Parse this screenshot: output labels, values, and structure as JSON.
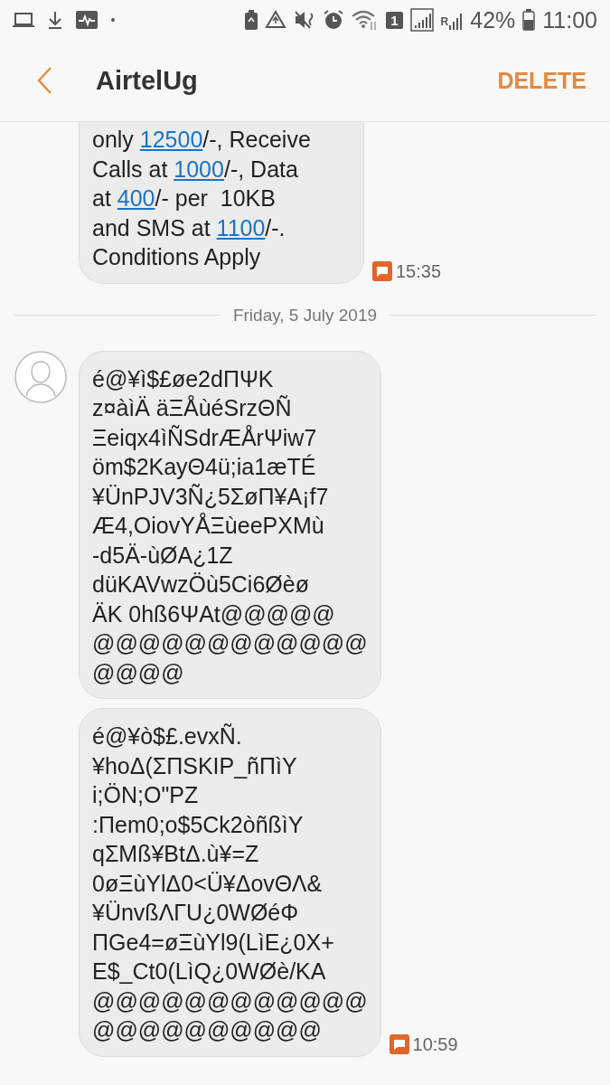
{
  "status_bar": {
    "sim_badge": "1",
    "roaming": "R",
    "battery": "42%",
    "time": "11:00"
  },
  "header": {
    "title": "AirtelUg",
    "action": "DELETE"
  },
  "messages": [
    {
      "kind": "incoming",
      "avatar": false,
      "time": "15:35",
      "lines": [
        [
          {
            "kind": "text",
            "text": "only "
          },
          {
            "kind": "link",
            "text": "12500"
          },
          {
            "kind": "text",
            "text": "/-, Receive"
          }
        ],
        [
          {
            "kind": "text",
            "text": "Calls at "
          },
          {
            "kind": "link",
            "text": "1000"
          },
          {
            "kind": "text",
            "text": "/-, Data"
          }
        ],
        [
          {
            "kind": "text",
            "text": "at "
          },
          {
            "kind": "link",
            "text": "400"
          },
          {
            "kind": "text",
            "text": "/- per  10KB"
          }
        ],
        [
          {
            "kind": "text",
            "text": "and SMS at "
          },
          {
            "kind": "link",
            "text": "1100"
          },
          {
            "kind": "text",
            "text": "/-."
          }
        ],
        [
          {
            "kind": "text",
            "text": "Conditions Apply"
          }
        ]
      ]
    },
    {
      "kind": "date",
      "text": "Friday, 5 July 2019"
    },
    {
      "kind": "incoming",
      "avatar": true,
      "lines": [
        [
          {
            "kind": "text",
            "text": "é@¥ì$£øe2dΠΨK"
          }
        ],
        [
          {
            "kind": "text",
            "text": "z¤àìÄ äΞÅùéSrzΘÑ"
          }
        ],
        [
          {
            "kind": "text",
            "text": "Ξeiqx4ìÑSdrÆÅrΨiw7"
          }
        ],
        [
          {
            "kind": "text",
            "text": "öm$2KayΘ4ü;ia1æTÉ"
          }
        ],
        [
          {
            "kind": "text",
            "text": "¥ÜnPJV3Ñ¿5ΣøΠ¥A¡f7"
          }
        ],
        [
          {
            "kind": "text",
            "text": "Æ4,OiovYÅΞùeePXMù"
          }
        ],
        [
          {
            "kind": "text",
            "text": "-d5Ä-ùØA¿1Z"
          }
        ],
        [
          {
            "kind": "text",
            "text": "düKAVwzÖù5Ci6Øèø"
          }
        ],
        [
          {
            "kind": "text",
            "text": "ÄK 0hß6ΨAt@@@@@"
          }
        ],
        [
          {
            "kind": "text",
            "text": "@@@@@@@@@@@@"
          }
        ],
        [
          {
            "kind": "text",
            "text": "@@@@"
          }
        ]
      ]
    },
    {
      "kind": "incoming",
      "avatar": false,
      "time": "10:59",
      "lines": [
        [
          {
            "kind": "text",
            "text": "é@¥ò$£.evxÑ."
          }
        ],
        [
          {
            "kind": "text",
            "text": "¥hoΔ(ΣΠSKIP_ñΠìY"
          }
        ],
        [
          {
            "kind": "text",
            "text": "i;ÖN;O\"PZ"
          }
        ],
        [
          {
            "kind": "text",
            "text": ":Πem0;o$5Ck2òñßìY"
          }
        ],
        [
          {
            "kind": "text",
            "text": "qΣMß¥BtΔ.ù¥=Z"
          }
        ],
        [
          {
            "kind": "text",
            "text": "0øΞùYlΔ0<Ü¥ΔovΘΛ&"
          }
        ],
        [
          {
            "kind": "text",
            "text": "¥ÜnvßΛΓU¿0WØéΦ"
          }
        ],
        [
          {
            "kind": "text",
            "text": "ΠGe4=øΞùYl9(LìE¿0X+"
          }
        ],
        [
          {
            "kind": "text",
            "text": "E$_Ct0(LìQ¿0WØè/KA"
          }
        ],
        [
          {
            "kind": "text",
            "text": "@@@@@@@@@@@@"
          }
        ],
        [
          {
            "kind": "text",
            "text": "@@@@@@@@@@"
          }
        ]
      ]
    }
  ]
}
